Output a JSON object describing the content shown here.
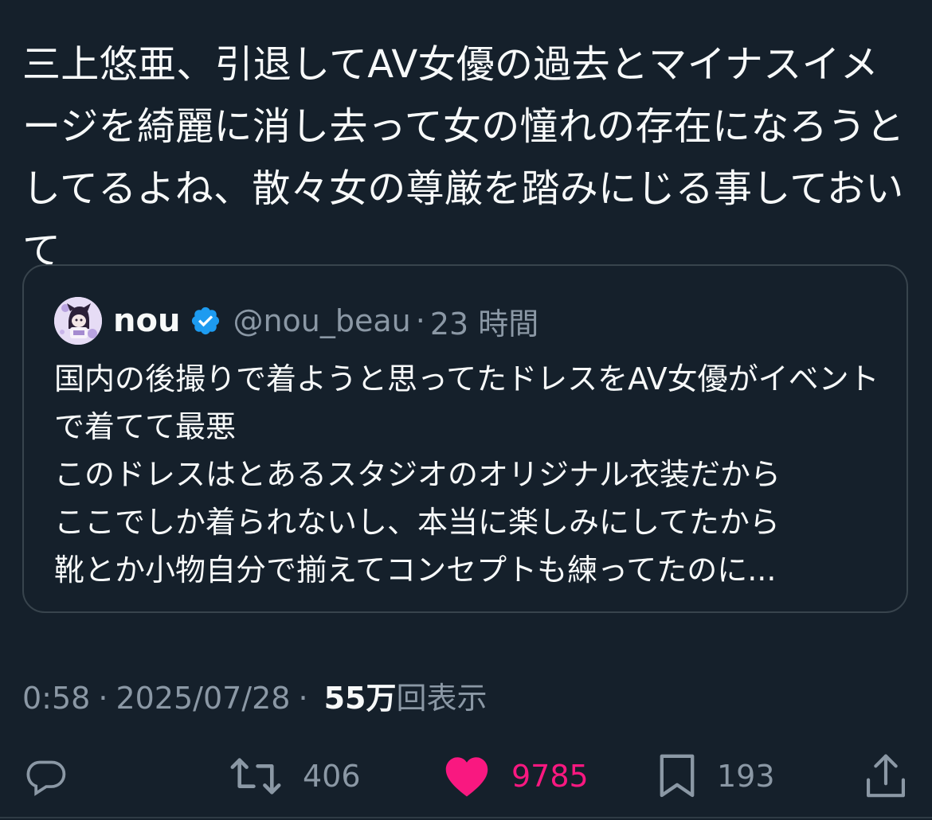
{
  "tweet": {
    "text": "三上悠亜、引退してAV女優の過去とマイナスイメージを綺麗に消し去って女の憧れの存在になろうとしてるよね、散々女の尊厳を踏みにじる事しておいて"
  },
  "quote": {
    "display_name": "nou",
    "handle": "@nou_beau",
    "separator": "·",
    "time_ago": "23 時間",
    "avatar_icon": "avatar-illustration-icon",
    "verified_icon": "verified-badge-icon",
    "text": "国内の後撮りで着ようと思ってたドレスをAV女優がイベントで着てて最悪\nこのドレスはとあるスタジオのオリジナル衣装だから\nここでしか着られないし、本当に楽しみにしてたから\n靴とか小物自分で揃えてコンセプトも練ってたのに..."
  },
  "meta": {
    "time": "0:58",
    "separator": "·",
    "date": "2025/07/28",
    "views_count": "55万",
    "views_label": "回表示"
  },
  "actions": {
    "reply_icon": "reply-icon",
    "retweet_icon": "retweet-icon",
    "retweet_count": "406",
    "like_icon": "heart-icon",
    "like_count": "9785",
    "bookmark_icon": "bookmark-icon",
    "bookmark_count": "193",
    "share_icon": "share-icon"
  },
  "colors": {
    "background": "#15202b",
    "text_primary": "#f7f9f9",
    "text_secondary": "#8b98a5",
    "like": "#f91880",
    "verified": "#1d9bf0",
    "border": "#38444d"
  }
}
